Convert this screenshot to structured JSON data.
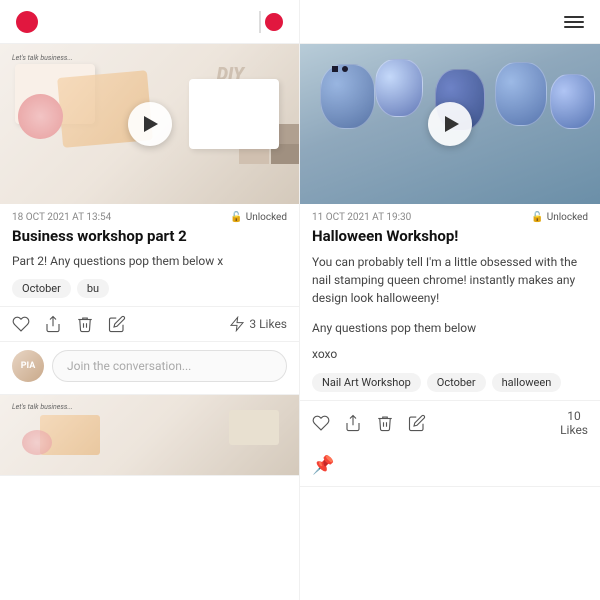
{
  "nav": {
    "left": {
      "hamburger_label": "menu",
      "logo_label": "patreon-logo"
    },
    "right": {
      "hamburger_label": "menu"
    }
  },
  "left_post": {
    "date": "18 OCT 2021 AT 13:54",
    "unlock_label": "Unlocked",
    "title": "Business workshop part 2",
    "description": "Part 2! Any questions pop them below x",
    "tags": [
      "October",
      "bu"
    ],
    "likes_count": "3 Likes",
    "comment_placeholder": "Join the conversation...",
    "thumb_text": "Let's talk business...",
    "play_label": "play video"
  },
  "left_post2": {
    "thumb_text": "Let's talk business..."
  },
  "right_post": {
    "date": "11 OCT 2021 AT 19:30",
    "unlock_label": "Unlocked",
    "title": "Halloween Workshop!",
    "description_1": "You can probably tell I'm a little obsessed with the nail stamping queen chrome! instantly makes any design look halloweeny!",
    "description_2": "Any questions pop them below",
    "description_3": "xoxo",
    "tags": [
      "Nail Art Workshop",
      "October",
      "halloween"
    ],
    "likes_count": "10",
    "likes_label": "Likes",
    "play_label": "play video"
  },
  "icons": {
    "heart": "♡",
    "share": "↑",
    "trash": "🗑",
    "edit": "✏",
    "lightning": "⚡",
    "lock": "🔒",
    "pin": "📌"
  }
}
